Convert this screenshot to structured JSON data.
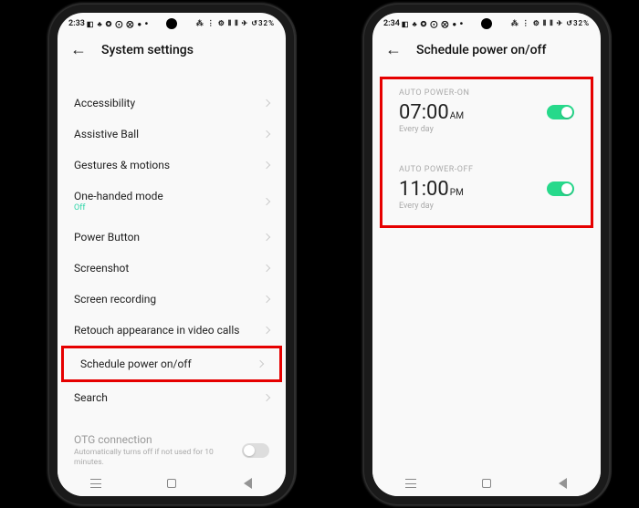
{
  "left": {
    "status": {
      "time": "2:33",
      "icons_left": "◧ ♣ ✪ ⨀ ⨂ ●",
      "more_dot": "•",
      "icons_right": "⁂ ⋮ ⚙ ⫴ ⫴ ✈ ↺32%"
    },
    "header": {
      "title": "System settings"
    },
    "items": [
      {
        "label": "Accessibility"
      },
      {
        "label": "Assistive Ball"
      },
      {
        "label": "Gestures & motions"
      },
      {
        "label": "One-handed mode",
        "sub": "Off"
      },
      {
        "label": "Power Button"
      },
      {
        "label": "Screenshot"
      },
      {
        "label": "Screen recording"
      },
      {
        "label": "Retouch appearance in video calls"
      },
      {
        "label": "Schedule power on/off",
        "hl": true
      },
      {
        "label": "Search"
      }
    ],
    "otg": {
      "title": "OTG connection",
      "desc": "Automatically turns off if not used for 10 minutes."
    }
  },
  "right": {
    "status": {
      "time": "2:34",
      "icons_left": "◧ ♣ ✪ ⨀ ⨂ ●",
      "more_dot": "•",
      "icons_right": "⁂ ⋮ ⚙ ⫴ ⫴ ✈ ↺32%"
    },
    "header": {
      "title": "Schedule power on/off"
    },
    "power_on": {
      "section": "AUTO POWER-ON",
      "time": "07:00",
      "ampm": "AM",
      "repeat": "Every day",
      "enabled": true
    },
    "power_off": {
      "section": "AUTO POWER-OFF",
      "time": "11:00",
      "ampm": "PM",
      "repeat": "Every day",
      "enabled": true
    }
  }
}
